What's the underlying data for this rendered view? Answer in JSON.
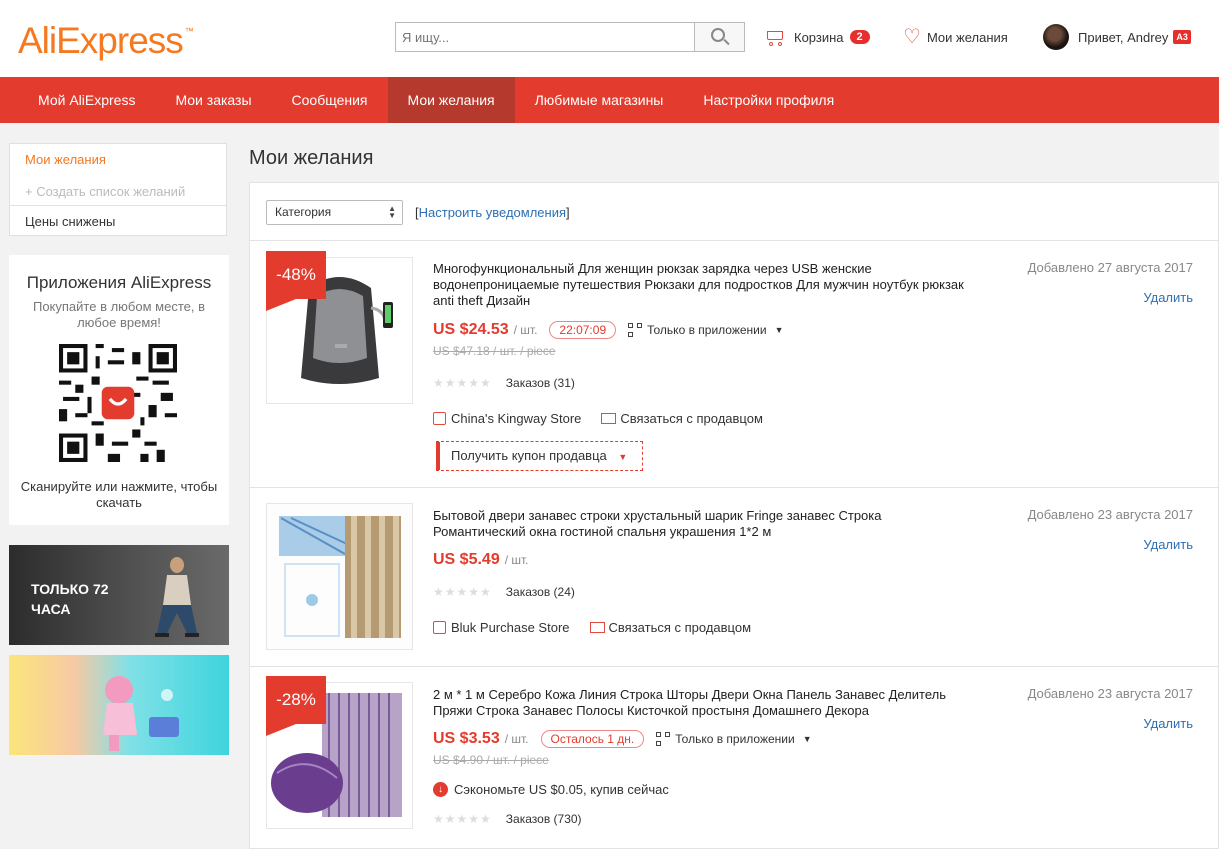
{
  "header": {
    "logo": "AliExpress",
    "logo_tm": "™",
    "search_placeholder": "Я ищу...",
    "cart_label": "Корзина",
    "cart_count": "2",
    "wishlist_label": "Мои желания",
    "greeting": "Привет, Andrey",
    "level": "A3"
  },
  "nav": {
    "items": [
      "Мой AliExpress",
      "Мои заказы",
      "Сообщения",
      "Мои желания",
      "Любимые магазины",
      "Настройки профиля"
    ],
    "active_index": 3
  },
  "sidebar": {
    "menu": [
      "Мои желания",
      "+ Создать список желаний",
      "Цены снижены"
    ],
    "app_title": "Приложения AliExpress",
    "app_subtitle": "Покупайте в любом месте, в любое время!",
    "app_hint": "Сканируйте или нажмите, чтобы скачать",
    "banner1_text_1": "ТОЛЬКО 72",
    "banner1_text_2": "ЧАСА"
  },
  "main": {
    "title": "Мои желания",
    "category_select": "Категория",
    "notify_bracket_open": "[",
    "notify_link": "Настроить уведомления",
    "notify_bracket_close": "]",
    "delete_label": "Удалить",
    "contact_label": "Связаться с продавцом",
    "app_only_label": "Только в приложении",
    "orders_prefix": "Заказов",
    "products": [
      {
        "discount": "-48%",
        "title": "Многофункциональный Для женщин рюкзак зарядка через USB женские водонепроницаемые путешествия Рюкзаки для подростков Для мужчин ноутбук рюкзак anti theft Дизайн",
        "date": "Добавлено 27 августа 2017",
        "price": "US $24.53",
        "unit": "/ шт.",
        "timer": "22:07:09",
        "old_price": "US $47.18 / шт. / piece",
        "orders": "Заказов (31)",
        "store": "China's Kingway Store",
        "coupon": "Получить купон продавца"
      },
      {
        "title": "Бытовой двери занавес строки хрустальный шарик Fringe занавес Строка Романтический окна гостиной спальня украшения 1*2 м",
        "date": "Добавлено 23 августа 2017",
        "price": "US $5.49",
        "unit": "/ шт.",
        "orders": "Заказов (24)",
        "store": "Bluk Purchase Store"
      },
      {
        "discount": "-28%",
        "title": "2 м * 1 м Серебро Кожа Линия Строка Шторы Двери Окна Панель Занавес Делитель Пряжи Строка Занавес Полосы Кисточкой простыня Домашнего Декора",
        "date": "Добавлено 23 августа 2017",
        "price": "US $3.53",
        "unit": "/ шт.",
        "timer": "Осталось 1 дн.",
        "old_price": "US $4.90 / шт. / piece",
        "save": "Сэкономьте US $0.05, купив сейчас",
        "orders": "Заказов (730)"
      }
    ]
  },
  "colors": {
    "brand_red": "#e33b2d",
    "logo_orange": "#f47920",
    "link_blue": "#2d6fb3"
  }
}
